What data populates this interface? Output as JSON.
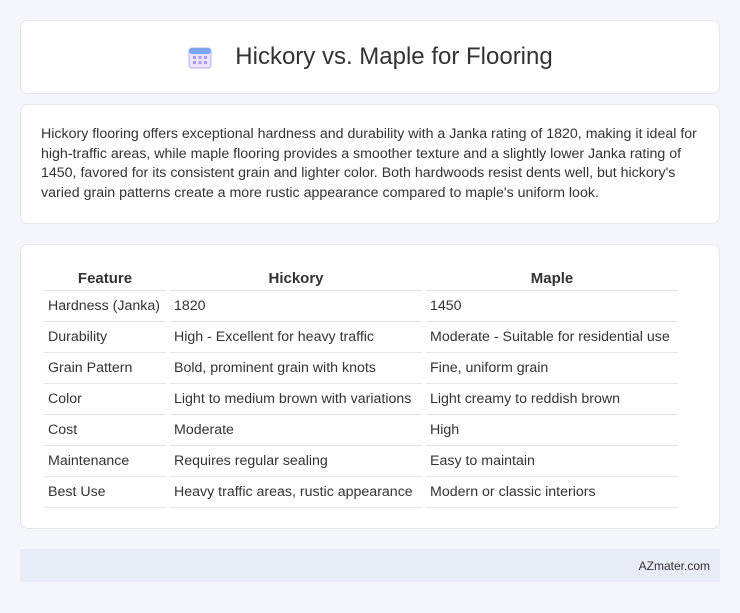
{
  "page": {
    "title": "Hickory vs. Maple for Flooring",
    "icon": "calendar-icon"
  },
  "intro": {
    "text": "Hickory flooring offers exceptional hardness and durability with a Janka rating of 1820, making it ideal for high-traffic areas, while maple flooring provides a smoother texture and a slightly lower Janka rating of 1450, favored for its consistent grain and lighter color. Both hardwoods resist dents well, but hickory's varied grain patterns create a more rustic appearance compared to maple's uniform look."
  },
  "table": {
    "headers": [
      "Feature",
      "Hickory",
      "Maple"
    ],
    "rows": [
      [
        "Hardness (Janka)",
        "1820",
        "1450"
      ],
      [
        "Durability",
        "High - Excellent for heavy traffic",
        "Moderate - Suitable for residential use"
      ],
      [
        "Grain Pattern",
        "Bold, prominent grain with knots",
        "Fine, uniform grain"
      ],
      [
        "Color",
        "Light to medium brown with variations",
        "Light creamy to reddish brown"
      ],
      [
        "Cost",
        "Moderate",
        "High"
      ],
      [
        "Maintenance",
        "Requires regular sealing",
        "Easy to maintain"
      ],
      [
        "Best Use",
        "Heavy traffic areas, rustic appearance",
        "Modern or classic interiors"
      ]
    ]
  },
  "footer": {
    "brand": "AZmater.com"
  }
}
